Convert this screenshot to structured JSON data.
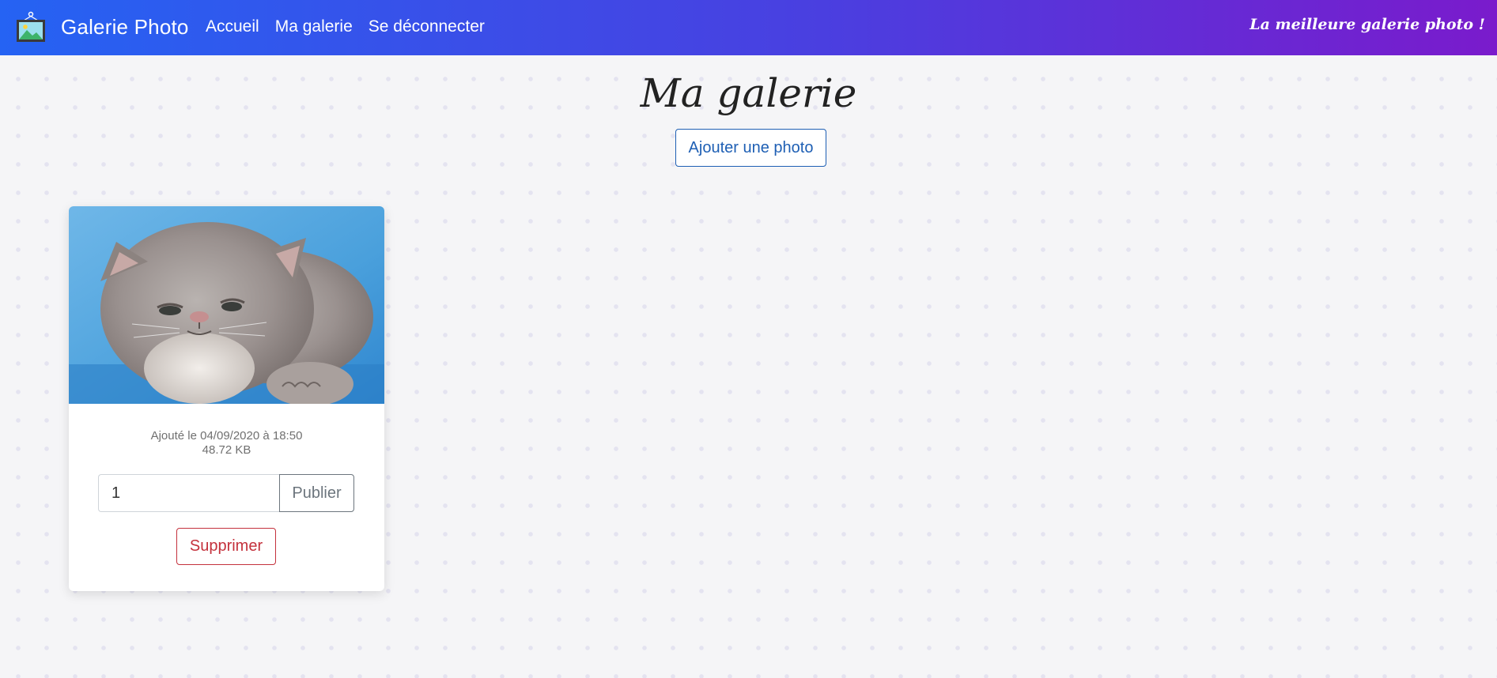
{
  "navbar": {
    "brand_icon": "picture-frame-icon",
    "brand": "Galerie Photo",
    "links": [
      {
        "label": "Accueil"
      },
      {
        "label": "Ma galerie"
      },
      {
        "label": "Se déconnecter"
      }
    ],
    "tagline": "La meilleure galerie photo !",
    "gradient_start": "#2563f3",
    "gradient_end": "#7a1bcc"
  },
  "page": {
    "title": "Ma galerie",
    "add_button": "Ajouter une photo"
  },
  "photos": [
    {
      "image": "grey-persian-cat-photo",
      "added": "Ajouté le 04/09/2020 à 18:50",
      "size": "48.72 KB",
      "input_value": "1",
      "publish_label": "Publier",
      "delete_label": "Supprimer"
    }
  ],
  "colors": {
    "primary": "#1e5fb4",
    "secondary": "#6c757d",
    "danger": "#c4313c"
  }
}
